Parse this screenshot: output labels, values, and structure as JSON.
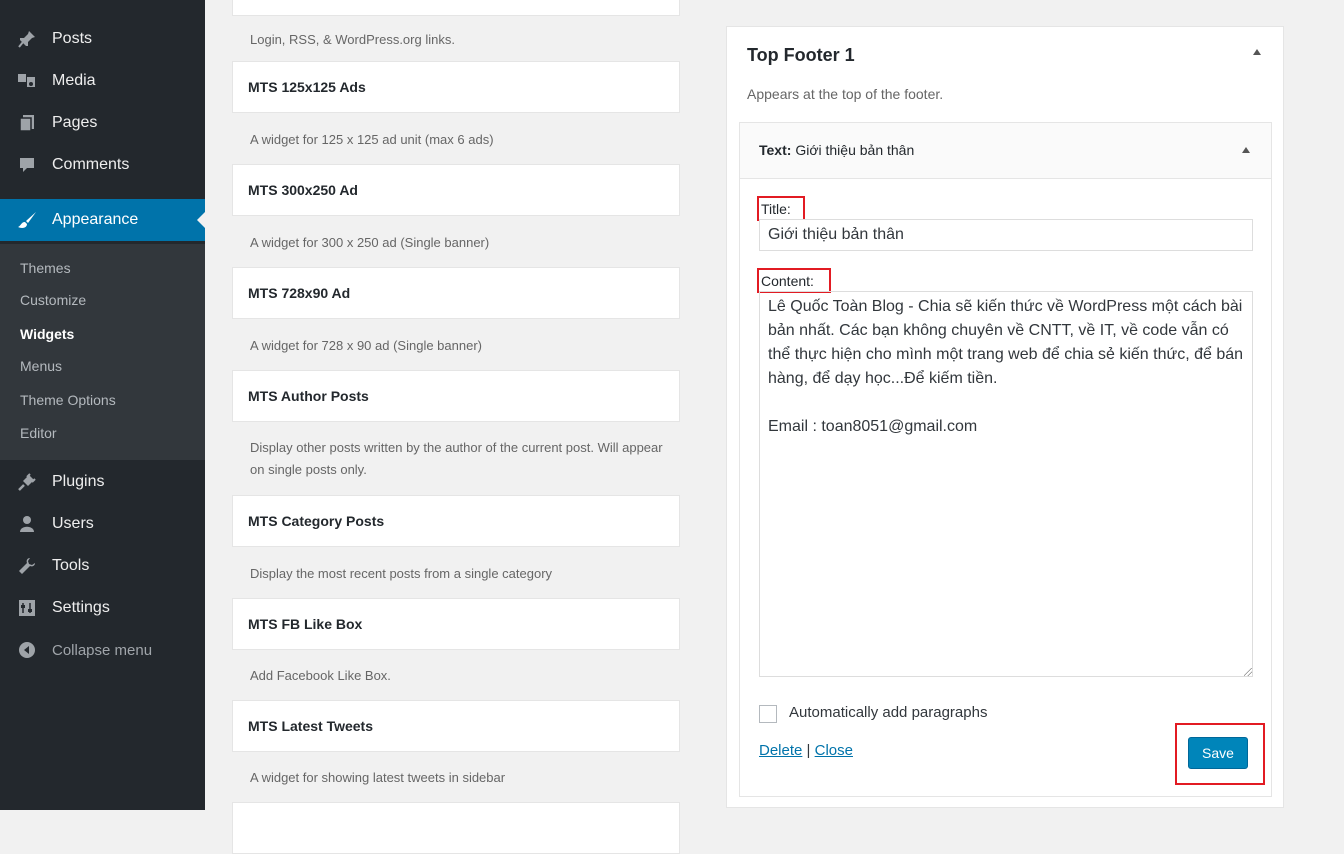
{
  "sidebar": {
    "items": [
      {
        "label": "Posts",
        "icon": "pushpin-icon"
      },
      {
        "label": "Media",
        "icon": "media-icon"
      },
      {
        "label": "Pages",
        "icon": "pages-icon"
      },
      {
        "label": "Comments",
        "icon": "comment-icon"
      },
      {
        "label": "Appearance",
        "icon": "paintbrush-icon"
      }
    ],
    "submenu": [
      "Themes",
      "Customize",
      "Widgets",
      "Menus",
      "Theme Options",
      "Editor"
    ],
    "current_submenu": "Widgets",
    "items_after": [
      {
        "label": "Plugins",
        "icon": "plug-icon"
      },
      {
        "label": "Users",
        "icon": "users-icon"
      },
      {
        "label": "Tools",
        "icon": "wrench-icon"
      },
      {
        "label": "Settings",
        "icon": "settings-icon"
      }
    ],
    "collapse_label": "Collapse menu"
  },
  "widgets": {
    "top_desc": "Login, RSS, & WordPress.org links.",
    "items": [
      {
        "title": "MTS 125x125 Ads",
        "desc": "A widget for 125 x 125 ad unit (max 6 ads)"
      },
      {
        "title": "MTS 300x250 Ad",
        "desc": "A widget for 300 x 250 ad (Single banner)"
      },
      {
        "title": "MTS 728x90 Ad",
        "desc": "A widget for 728 x 90 ad (Single banner)"
      },
      {
        "title": "MTS Author Posts",
        "desc": "Display other posts written by the author of the current post. Will appear on single posts only."
      },
      {
        "title": "MTS Category Posts",
        "desc": "Display the most recent posts from a single category"
      },
      {
        "title": "MTS FB Like Box",
        "desc": "Add Facebook Like Box."
      },
      {
        "title": "MTS Latest Tweets",
        "desc": "A widget for showing latest tweets in sidebar"
      }
    ]
  },
  "panel": {
    "title": "Top Footer 1",
    "description": "Appears at the top of the footer."
  },
  "text_widget": {
    "header_prefix": "Text:",
    "header_title": "Giới thiệu bản thân",
    "title_label": "Title:",
    "title_value": "Giới thiệu bản thân",
    "content_label": "Content:",
    "content_value": "Lê Quốc Toàn Blog - Chia sẽ kiến thức về WordPress một cách bài bản nhất. Các bạn không chuyên về CNTT, về IT, về code vẫn có thể thực hiện cho mình một trang web để chia sẻ kiến thức, để bán hàng, để dạy học...Để kiếm tiền.\n\nEmail : toan8051@gmail.com",
    "autop_label": "Automatically add paragraphs",
    "autop_checked": false,
    "delete_label": "Delete",
    "separator": "|",
    "close_label": "Close",
    "save_label": "Save"
  },
  "colors": {
    "sidebar_bg": "#23282d",
    "submenu_bg": "#32373c",
    "accent": "#0073aa",
    "save_button": "#0085ba",
    "highlight_box": "#e21b23"
  }
}
